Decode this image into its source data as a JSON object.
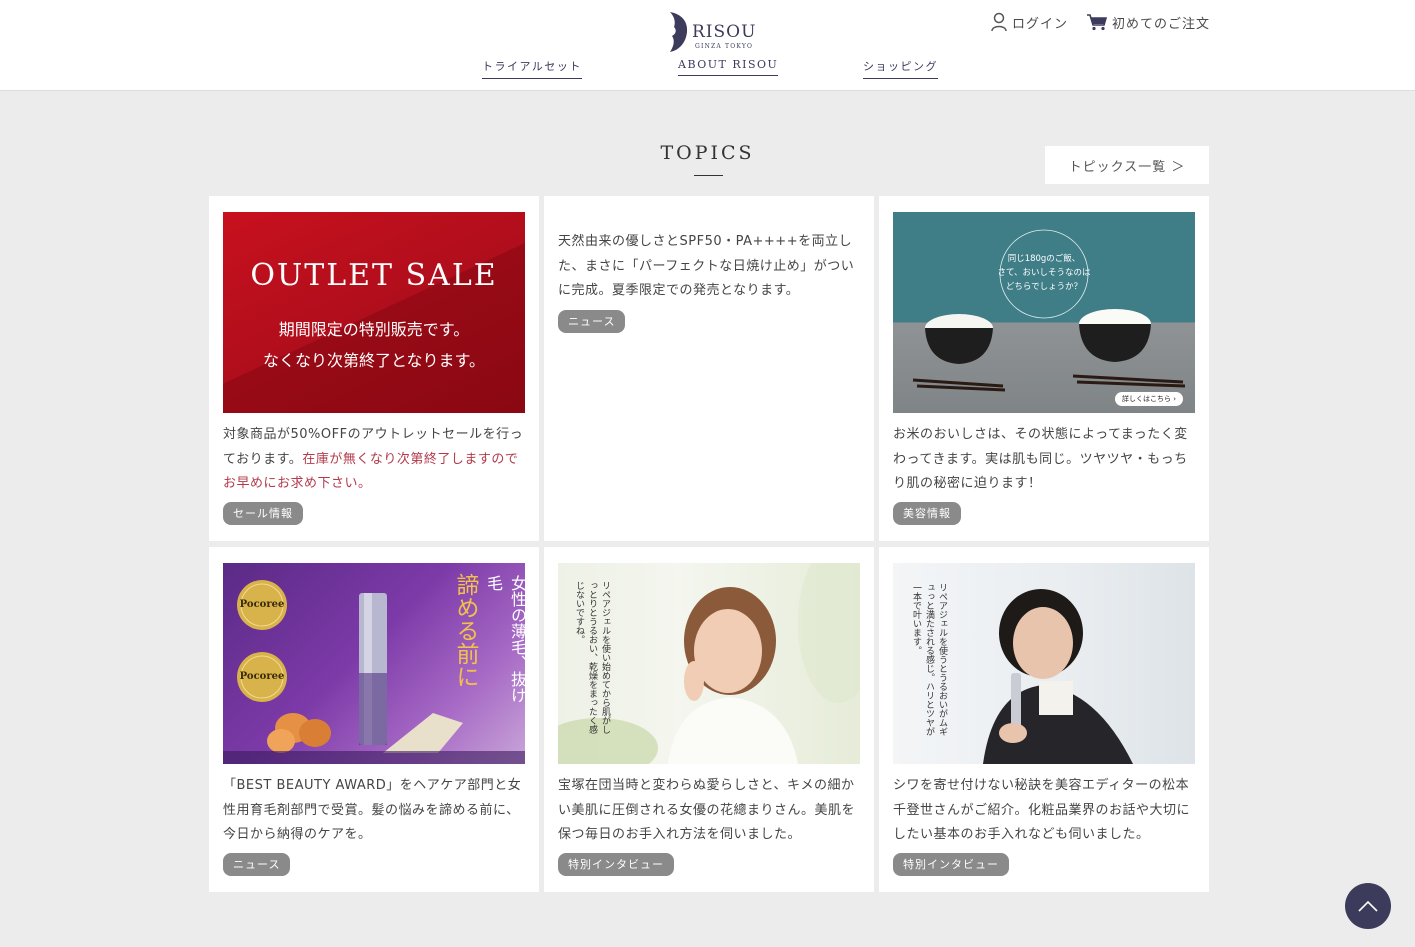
{
  "header": {
    "logo_text": "RISOU",
    "logo_sub": "GINZA TOKYO",
    "login_label": "ログイン",
    "order_label": "初めてのご注文"
  },
  "nav": [
    {
      "label": "トライアルセット"
    },
    {
      "label": "ABOUT RISOU"
    },
    {
      "label": "ショッピング"
    }
  ],
  "topics": {
    "title": "TOPICS",
    "all_link": "トピックス一覧 ＞"
  },
  "cards": [
    {
      "image": {
        "line1": "OUTLET SALE",
        "line2": "期間限定の特別販売です。",
        "line3": "なくなり次第終了となります。"
      },
      "desc_plain": "対象商品が50%OFFのアウトレットセールを行っております。",
      "desc_highlight": "在庫が無くなり次第終了しますのでお早めにお求め下さい。",
      "tag": "セール情報"
    },
    {
      "desc": "天然由来の優しさとSPF50・PA++++を両立した、まさに「パーフェクトな日焼け止め」がついに完成。夏季限定での発売となります。",
      "tag": "ニュース"
    },
    {
      "image": {
        "bubble1": "同じ180gのご飯、",
        "bubble2": "さて、おいしそうなのは",
        "bubble3": "どちらでしょうか？",
        "badge": "詳しくはこちら ›"
      },
      "desc": "お米のおいしさは、その状態によってまったく変わってきます。実は肌も同じ。ツヤツヤ・もっちり肌の秘密に迫ります！",
      "tag": "美容情報"
    },
    {
      "image": {
        "award1": "Pocoree",
        "award2": "Pocoree",
        "vtext1": "女性の薄毛、抜け毛",
        "vtext2": "諦める前に"
      },
      "desc": "「BEST BEAUTY AWARD」をヘアケア部門と女性用育毛剤部門で受賞。髪の悩みを諦める前に、今日から納得のケアを。",
      "tag": "ニュース"
    },
    {
      "image": {
        "vtext": "リペアジェルを使い始めてから肌がしっとりとうるおい、乾燥をまったく感じないですね。"
      },
      "desc": "宝塚在団当時と変わらぬ愛らしさと、キメの細かい美肌に圧倒される女優の花總まりさん。美肌を保つ毎日のお手入れ方法を伺いました。",
      "tag": "特別インタビュー"
    },
    {
      "image": {
        "vtext": "リペアジェルを使うとうるおいがムギュっと満たされる感じ。ハリとツヤが一本で叶います。"
      },
      "desc": "シワを寄せ付けない秘訣を美容エディターの松本千登世さんがご紹介。化粧品業界のお話や大切にしたい基本のお手入れなども伺いました。",
      "tag": "特別インタビュー"
    }
  ],
  "colors": {
    "brand": "#3c3b5c",
    "sale_red": "#b01020",
    "highlight": "#b23a4a",
    "tag": "#8a8a8a"
  }
}
